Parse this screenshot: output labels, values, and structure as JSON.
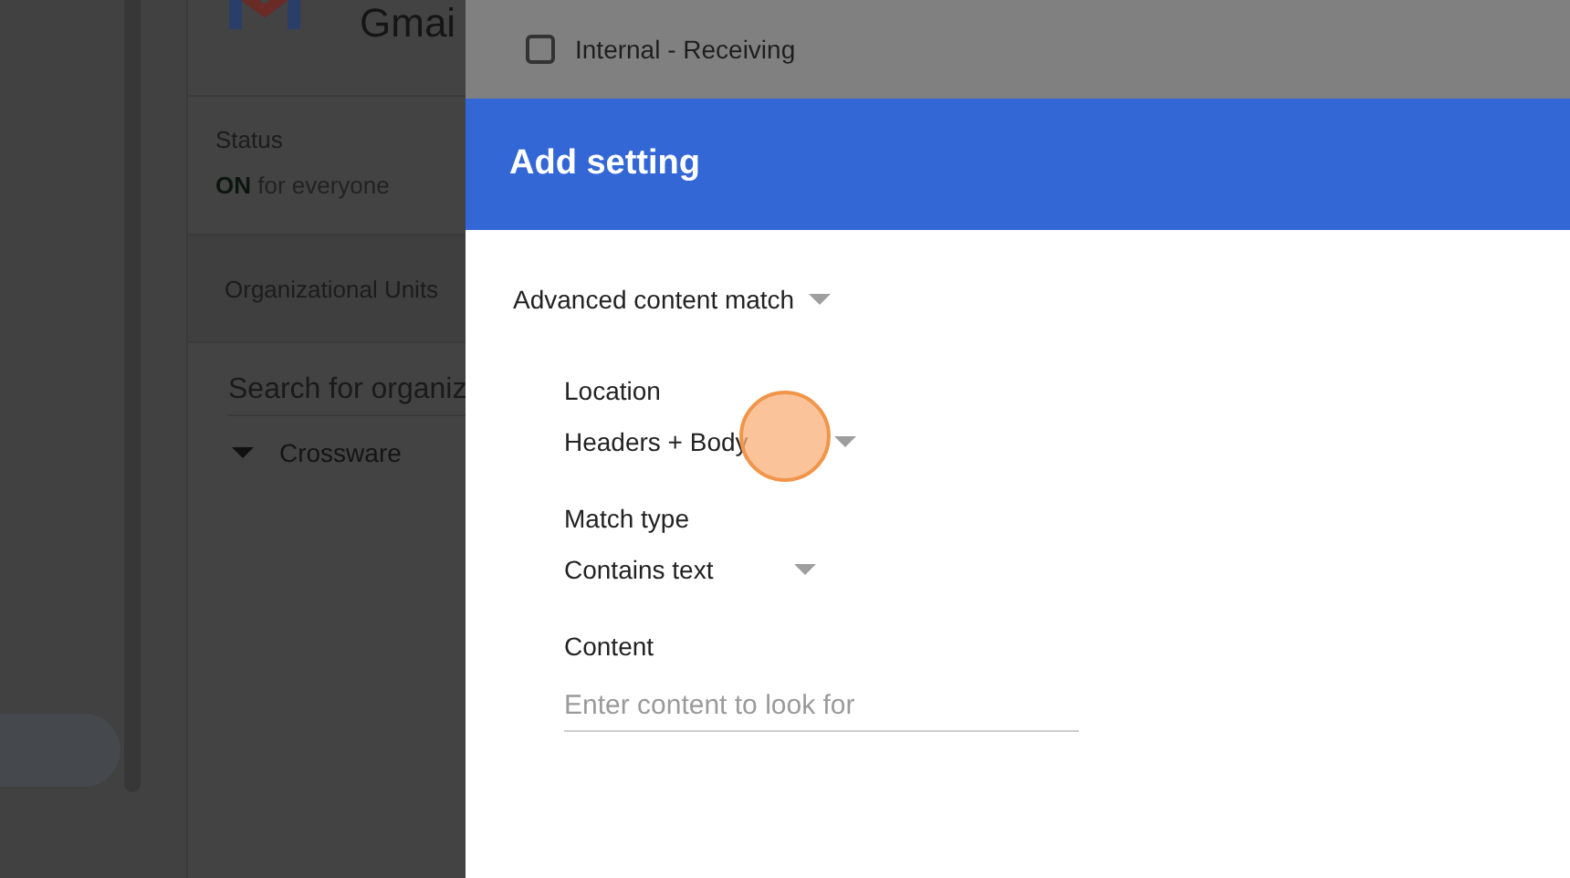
{
  "background_page": {
    "app_title": "Gmai",
    "status": {
      "label": "Status",
      "state_word": "ON",
      "state_rest": "for everyone"
    },
    "org_units_label": "Organizational Units",
    "search": {
      "placeholder": "Search for organiz"
    },
    "tree": [
      {
        "label": "Crossware",
        "expanded": true
      }
    ]
  },
  "dialog": {
    "top_option": {
      "label": "Internal - Receiving",
      "checked": false
    },
    "title": "Add setting",
    "type_dropdown": "Advanced content match",
    "fields": [
      {
        "kind": "dropdown",
        "label": "Location",
        "value": "Headers + Body"
      },
      {
        "kind": "dropdown",
        "label": "Match type",
        "value": "Contains text"
      },
      {
        "kind": "text",
        "label": "Content",
        "placeholder": "Enter content to look for"
      }
    ]
  }
}
